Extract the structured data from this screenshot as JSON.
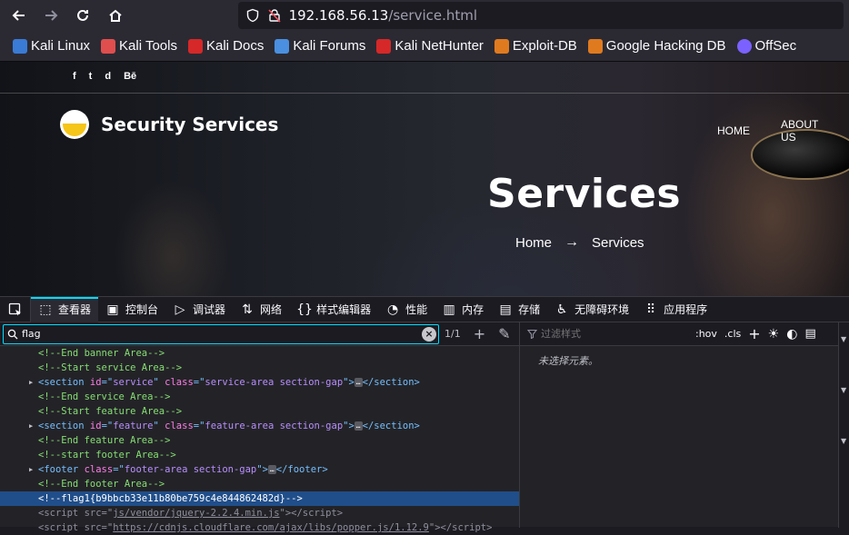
{
  "browser": {
    "url_host": "192.168.56.13",
    "url_path": "/service.html",
    "bookmarks": [
      {
        "label": "Kali Linux",
        "color": "#3a7bd5"
      },
      {
        "label": "Kali Tools",
        "color": "#e04e4e"
      },
      {
        "label": "Kali Docs",
        "color": "#d62828"
      },
      {
        "label": "Kali Forums",
        "color": "#4a8fe0"
      },
      {
        "label": "Kali NetHunter",
        "color": "#d62828"
      },
      {
        "label": "Exploit-DB",
        "color": "#e07a1f"
      },
      {
        "label": "Google Hacking DB",
        "color": "#e07a1f"
      },
      {
        "label": "OffSec",
        "color": "#7b61ff"
      }
    ]
  },
  "site": {
    "social": [
      "f",
      "t",
      "d",
      "Bē"
    ],
    "title": "Security Services",
    "menu": [
      "HOME",
      "ABOUT US"
    ],
    "hero": "Services",
    "breadcrumb_home": "Home",
    "breadcrumb_arrow": "→",
    "breadcrumb_current": "Services"
  },
  "devtools": {
    "tabs": [
      {
        "label": "查看器",
        "icon": "inspector-icon",
        "glyph": "⬚",
        "active": true
      },
      {
        "label": "控制台",
        "icon": "console-icon",
        "glyph": "▣"
      },
      {
        "label": "调试器",
        "icon": "debugger-icon",
        "glyph": "▷"
      },
      {
        "label": "网络",
        "icon": "network-icon",
        "glyph": "⇅"
      },
      {
        "label": "样式编辑器",
        "icon": "style-editor-icon",
        "glyph": "{}"
      },
      {
        "label": "性能",
        "icon": "performance-icon",
        "glyph": "◔"
      },
      {
        "label": "内存",
        "icon": "memory-icon",
        "glyph": "▥"
      },
      {
        "label": "存储",
        "icon": "storage-icon",
        "glyph": "▤"
      },
      {
        "label": "无障碍环境",
        "icon": "accessibility-icon",
        "glyph": "♿"
      },
      {
        "label": "应用程序",
        "icon": "application-icon",
        "glyph": "⠿"
      }
    ],
    "search_value": "flag",
    "match_count": "1/1",
    "filter_placeholder": "过滤样式",
    "hov_label": ":hov",
    "cls_label": ".cls",
    "no_element_text": "未选择元素。",
    "markup": [
      {
        "kind": "comment",
        "text": "<!--End banner Area-->"
      },
      {
        "kind": "comment",
        "text": "<!--Start service Area-->"
      },
      {
        "kind": "element",
        "tag": "section",
        "attrs": [
          [
            "id",
            "service"
          ],
          [
            "class",
            "service-area section-gap"
          ]
        ]
      },
      {
        "kind": "comment",
        "text": "<!--End service Area-->"
      },
      {
        "kind": "comment",
        "text": "<!--Start feature Area-->"
      },
      {
        "kind": "element",
        "tag": "section",
        "attrs": [
          [
            "id",
            "feature"
          ],
          [
            "class",
            "feature-area section-gap"
          ]
        ]
      },
      {
        "kind": "comment",
        "text": "<!--End feature Area-->"
      },
      {
        "kind": "comment",
        "text": "<!--start footer Area-->"
      },
      {
        "kind": "element",
        "tag": "footer",
        "attrs": [
          [
            "class",
            "footer-area section-gap"
          ]
        ]
      },
      {
        "kind": "comment",
        "text": "<!--End footer Area-->"
      },
      {
        "kind": "comment",
        "text": "<!--flag1{b9bbcb33e11b80be759c4e844862482d}-->",
        "selected": true
      },
      {
        "kind": "script",
        "src": "js/vendor/jquery-2.2.4.min.js"
      },
      {
        "kind": "script",
        "src": "https://cdnjs.cloudflare.com/ajax/libs/popper.js/1.12.9"
      }
    ]
  }
}
